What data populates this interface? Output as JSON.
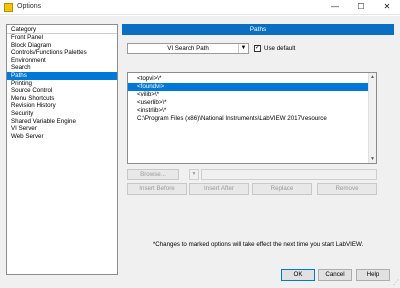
{
  "window": {
    "title": "Options",
    "minimize": "—",
    "maximize": "☐",
    "close": "✕"
  },
  "categories": {
    "header": "Category",
    "items": [
      {
        "label": "Front Panel"
      },
      {
        "label": "Block Diagram"
      },
      {
        "label": "Controls/Functions Palettes"
      },
      {
        "label": "Environment"
      },
      {
        "label": "Search"
      },
      {
        "label": "Paths",
        "selected": true
      },
      {
        "label": "Printing"
      },
      {
        "label": "Source Control"
      },
      {
        "label": "Menu Shortcuts"
      },
      {
        "label": "Revision History"
      },
      {
        "label": "Security"
      },
      {
        "label": "Shared Variable Engine"
      },
      {
        "label": "VI Server"
      },
      {
        "label": "Web Server"
      }
    ]
  },
  "paths_panel": {
    "header": "Paths",
    "path_type": "VI Search Path",
    "use_default_label": "Use default",
    "use_default_checked": true,
    "entries": [
      "<topvi>\\*",
      "<foundvi>",
      "<vilib>\\*",
      "<userlib>\\*",
      "<instrlib>\\*",
      "C:\\Program Files (x86)\\National Instruments\\LabVIEW 2017\\resource"
    ],
    "selected_entry_index": 1,
    "browse_label": "Browse...",
    "insert_before_label": "Insert Before",
    "insert_after_label": "Insert After",
    "replace_label": "Replace",
    "remove_label": "Remove"
  },
  "note": "*Changes to marked options will take effect the next time you start LabVIEW.",
  "footer": {
    "ok_label": "OK",
    "cancel_label": "Cancel",
    "help_label": "Help"
  },
  "colors": {
    "accent": "#0078d7",
    "panel_header": "#0a6fc2"
  }
}
